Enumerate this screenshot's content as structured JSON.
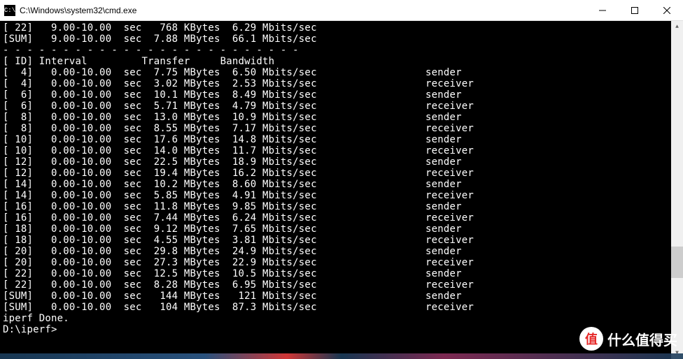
{
  "window": {
    "title": "C:\\Windows\\system32\\cmd.exe",
    "icon_label": "cmd-icon"
  },
  "pre_rows": [
    {
      "id": "[ 22]",
      "interval": "  9.00-10.00 ",
      "unit": "sec",
      "transfer": "  768 KBytes",
      "bandwidth": " 6.29 Mbits/sec",
      "role": ""
    },
    {
      "id": "[SUM]",
      "interval": "  9.00-10.00 ",
      "unit": "sec",
      "transfer": " 7.88 MBytes",
      "bandwidth": " 66.1 Mbits/sec",
      "role": ""
    }
  ],
  "divider": "- - - - - - - - - - - - - - - - - - - - - - - - -",
  "header": {
    "id": "[ ID]",
    "interval": "Interval     ",
    "unit": "   ",
    "transfer": "Transfer    ",
    "bandwidth": "Bandwidth"
  },
  "rows": [
    {
      "id": "[  4]",
      "interval": "  0.00-10.00 ",
      "unit": "sec",
      "transfer": " 7.75 MBytes",
      "bandwidth": " 6.50 Mbits/sec",
      "role": "sender"
    },
    {
      "id": "[  4]",
      "interval": "  0.00-10.00 ",
      "unit": "sec",
      "transfer": " 3.02 MBytes",
      "bandwidth": " 2.53 Mbits/sec",
      "role": "receiver"
    },
    {
      "id": "[  6]",
      "interval": "  0.00-10.00 ",
      "unit": "sec",
      "transfer": " 10.1 MBytes",
      "bandwidth": " 8.49 Mbits/sec",
      "role": "sender"
    },
    {
      "id": "[  6]",
      "interval": "  0.00-10.00 ",
      "unit": "sec",
      "transfer": " 5.71 MBytes",
      "bandwidth": " 4.79 Mbits/sec",
      "role": "receiver"
    },
    {
      "id": "[  8]",
      "interval": "  0.00-10.00 ",
      "unit": "sec",
      "transfer": " 13.0 MBytes",
      "bandwidth": " 10.9 Mbits/sec",
      "role": "sender"
    },
    {
      "id": "[  8]",
      "interval": "  0.00-10.00 ",
      "unit": "sec",
      "transfer": " 8.55 MBytes",
      "bandwidth": " 7.17 Mbits/sec",
      "role": "receiver"
    },
    {
      "id": "[ 10]",
      "interval": "  0.00-10.00 ",
      "unit": "sec",
      "transfer": " 17.6 MBytes",
      "bandwidth": " 14.8 Mbits/sec",
      "role": "sender"
    },
    {
      "id": "[ 10]",
      "interval": "  0.00-10.00 ",
      "unit": "sec",
      "transfer": " 14.0 MBytes",
      "bandwidth": " 11.7 Mbits/sec",
      "role": "receiver"
    },
    {
      "id": "[ 12]",
      "interval": "  0.00-10.00 ",
      "unit": "sec",
      "transfer": " 22.5 MBytes",
      "bandwidth": " 18.9 Mbits/sec",
      "role": "sender"
    },
    {
      "id": "[ 12]",
      "interval": "  0.00-10.00 ",
      "unit": "sec",
      "transfer": " 19.4 MBytes",
      "bandwidth": " 16.2 Mbits/sec",
      "role": "receiver"
    },
    {
      "id": "[ 14]",
      "interval": "  0.00-10.00 ",
      "unit": "sec",
      "transfer": " 10.2 MBytes",
      "bandwidth": " 8.60 Mbits/sec",
      "role": "sender"
    },
    {
      "id": "[ 14]",
      "interval": "  0.00-10.00 ",
      "unit": "sec",
      "transfer": " 5.85 MBytes",
      "bandwidth": " 4.91 Mbits/sec",
      "role": "receiver"
    },
    {
      "id": "[ 16]",
      "interval": "  0.00-10.00 ",
      "unit": "sec",
      "transfer": " 11.8 MBytes",
      "bandwidth": " 9.85 Mbits/sec",
      "role": "sender"
    },
    {
      "id": "[ 16]",
      "interval": "  0.00-10.00 ",
      "unit": "sec",
      "transfer": " 7.44 MBytes",
      "bandwidth": " 6.24 Mbits/sec",
      "role": "receiver"
    },
    {
      "id": "[ 18]",
      "interval": "  0.00-10.00 ",
      "unit": "sec",
      "transfer": " 9.12 MBytes",
      "bandwidth": " 7.65 Mbits/sec",
      "role": "sender"
    },
    {
      "id": "[ 18]",
      "interval": "  0.00-10.00 ",
      "unit": "sec",
      "transfer": " 4.55 MBytes",
      "bandwidth": " 3.81 Mbits/sec",
      "role": "receiver"
    },
    {
      "id": "[ 20]",
      "interval": "  0.00-10.00 ",
      "unit": "sec",
      "transfer": " 29.8 MBytes",
      "bandwidth": " 24.9 Mbits/sec",
      "role": "sender"
    },
    {
      "id": "[ 20]",
      "interval": "  0.00-10.00 ",
      "unit": "sec",
      "transfer": " 27.3 MBytes",
      "bandwidth": " 22.9 Mbits/sec",
      "role": "receiver"
    },
    {
      "id": "[ 22]",
      "interval": "  0.00-10.00 ",
      "unit": "sec",
      "transfer": " 12.5 MBytes",
      "bandwidth": " 10.5 Mbits/sec",
      "role": "sender"
    },
    {
      "id": "[ 22]",
      "interval": "  0.00-10.00 ",
      "unit": "sec",
      "transfer": " 8.28 MBytes",
      "bandwidth": " 6.95 Mbits/sec",
      "role": "receiver"
    },
    {
      "id": "[SUM]",
      "interval": "  0.00-10.00 ",
      "unit": "sec",
      "transfer": "  144 MBytes",
      "bandwidth": "  121 Mbits/sec",
      "role": "sender"
    },
    {
      "id": "[SUM]",
      "interval": "  0.00-10.00 ",
      "unit": "sec",
      "transfer": "  104 MBytes",
      "bandwidth": " 87.3 Mbits/sec",
      "role": "receiver"
    }
  ],
  "done_line": "iperf Done.",
  "prompt": "D:\\iperf>",
  "watermark": {
    "badge": "值",
    "text": "什么值得买"
  }
}
